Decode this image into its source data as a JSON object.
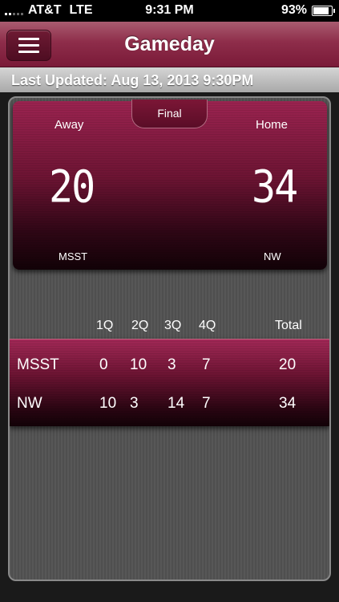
{
  "status_bar": {
    "carrier": "AT&T",
    "network": "LTE",
    "time": "9:31 PM",
    "battery": "93%",
    "battery_level": 0.93
  },
  "nav": {
    "title": "Gameday",
    "menu_icon": "hamburger-menu-icon"
  },
  "last_updated": "Last Updated: Aug 13, 2013 9:30PM",
  "scoreboard": {
    "status": "Final",
    "away_label": "Away",
    "home_label": "Home",
    "away_score": "20",
    "home_score": "34",
    "away_team": "MSST",
    "home_team": "NW"
  },
  "linescore": {
    "headers": [
      "1Q",
      "2Q",
      "3Q",
      "4Q",
      "Total"
    ],
    "rows": [
      {
        "team": "MSST",
        "q": [
          "0",
          "10",
          "3",
          "7"
        ],
        "total": "20"
      },
      {
        "team": "NW",
        "q": [
          "10",
          "3",
          "14",
          "7"
        ],
        "total": "34"
      }
    ]
  },
  "colors": {
    "maroon": "#7a1a38",
    "accent": "#9b2350"
  }
}
